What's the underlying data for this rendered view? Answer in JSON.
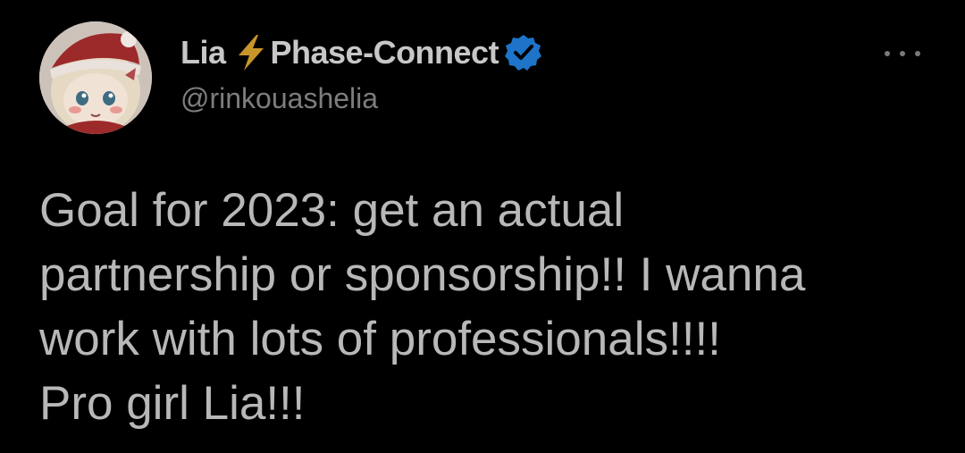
{
  "tweet": {
    "author": {
      "name_first": "Lia",
      "name_rest": "Phase-Connect",
      "handle": "@rinkouashelia"
    },
    "text_lines": [
      "Goal for 2023: get an actual",
      "partnership or sponsorship!! I wanna",
      "work with lots of professionals!!!!",
      "Pro girl Lia!!!"
    ]
  },
  "colors": {
    "background": "#000000",
    "verified_badge": "#1d74c9",
    "bolt": "#c8952a"
  }
}
